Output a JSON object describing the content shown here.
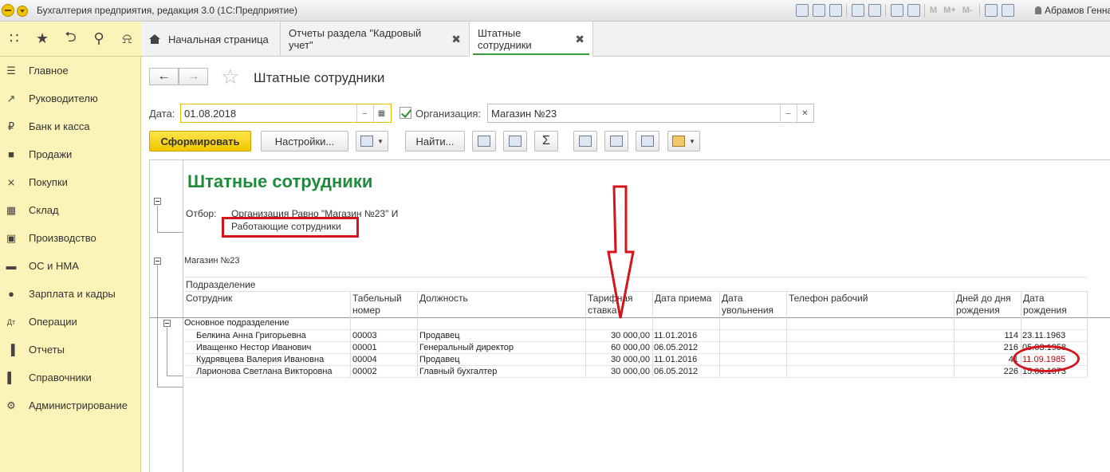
{
  "app": {
    "title": "Бухгалтерия предприятия, редакция 3.0  (1С:Предприятие)",
    "user": "Абрамов Генна",
    "toolbar_text": [
      "M",
      "M+",
      "M-"
    ]
  },
  "tabs": [
    {
      "label": "Начальная страница",
      "icon": "home-icon",
      "closable": false
    },
    {
      "label": "Отчеты раздела \"Кадровый учет\"",
      "closable": true
    },
    {
      "label": "Штатные сотрудники",
      "closable": true,
      "active": true
    }
  ],
  "sidebar": {
    "top_icons": [
      "apps-grid-icon",
      "star-icon",
      "history-icon",
      "search-icon",
      "bell-icon"
    ],
    "items": [
      {
        "label": "Главное",
        "icon": "menu-icon"
      },
      {
        "label": "Руководителю",
        "icon": "trend-icon"
      },
      {
        "label": "Банк и касса",
        "icon": "coin-icon"
      },
      {
        "label": "Продажи",
        "icon": "bag-icon"
      },
      {
        "label": "Покупки",
        "icon": "cart-icon"
      },
      {
        "label": "Склад",
        "icon": "warehouse-icon"
      },
      {
        "label": "Производство",
        "icon": "factory-icon"
      },
      {
        "label": "ОС и НМА",
        "icon": "truck-icon"
      },
      {
        "label": "Зарплата и кадры",
        "icon": "person-icon"
      },
      {
        "label": "Операции",
        "icon": "debit-credit-icon"
      },
      {
        "label": "Отчеты",
        "icon": "bar-chart-icon"
      },
      {
        "label": "Справочники",
        "icon": "book-icon"
      },
      {
        "label": "Администрирование",
        "icon": "gear-icon"
      }
    ]
  },
  "page": {
    "title": "Штатные сотрудники",
    "date_label": "Дата:",
    "date_value": "01.08.2018",
    "org_checked": true,
    "org_label": "Организация:",
    "org_value": "Магазин №23",
    "buttons": {
      "generate": "Сформировать",
      "settings": "Настройки...",
      "find": "Найти..."
    }
  },
  "report": {
    "title": "Штатные сотрудники",
    "filter_label": "Отбор:",
    "filter_line1": "Организация Равно \"Магазин №23\" И",
    "filter_line2": "Работающие сотрудники",
    "org": "Магазин №23",
    "group_header": "Подразделение",
    "columns": {
      "employee": "Сотрудник",
      "tab_num_1": "Табельный",
      "tab_num_2": "номер",
      "position": "Должность",
      "rate_1": "Тарифная",
      "rate_2": "ставка",
      "hire": "Дата приема",
      "fire_1": "Дата",
      "fire_2": "увольнения",
      "phone": "Телефон рабочий",
      "days_1": "Дней до дня",
      "days_2": "рождения",
      "birth_1": "Дата",
      "birth_2": "рождения"
    },
    "group": "Основное подразделение",
    "rows": [
      {
        "name": "Белкина Анна Григорьевна",
        "num": "00003",
        "position": "Продавец",
        "rate": "30 000,00",
        "hire": "11.01.2016",
        "fire": "",
        "phone": "",
        "days": "114",
        "birth": "23.11.1963"
      },
      {
        "name": "Иващенко Нестор Иванович",
        "num": "00001",
        "position": "Генеральный директор",
        "rate": "60 000,00",
        "hire": "06.05.2012",
        "fire": "",
        "phone": "",
        "days": "216",
        "birth": "05.03.1958"
      },
      {
        "name": "Кудрявцева Валерия Ивановна",
        "num": "00004",
        "position": "Продавец",
        "rate": "30 000,00",
        "hire": "11.01.2016",
        "fire": "",
        "phone": "",
        "days": "41",
        "birth": "11.09.1985",
        "highlight": true
      },
      {
        "name": "Ларионова Светлана Викторовна",
        "num": "00002",
        "position": "Главный бухгалтер",
        "rate": "30 000,00",
        "hire": "06.05.2012",
        "fire": "",
        "phone": "",
        "days": "226",
        "birth": "15.03.1973"
      }
    ]
  },
  "colors": {
    "sidebar_bg": "#fbf3b8",
    "primary_btn": "#f1c700",
    "report_title": "#1e8c3c",
    "annotation_red": "#d4131b"
  }
}
